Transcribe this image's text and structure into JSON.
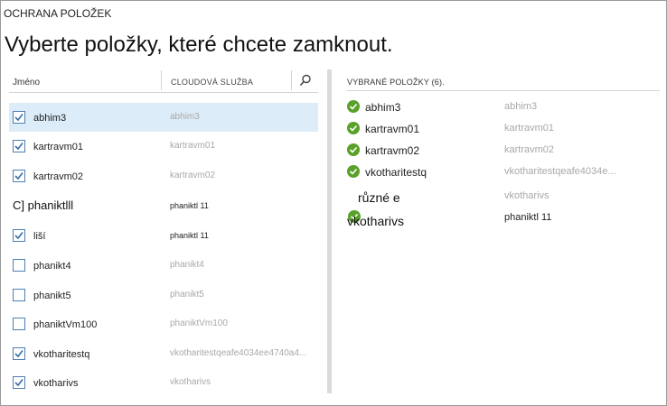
{
  "section_title": "OCHRANA POLOŽEK",
  "page_title": "Vyberte položky, které chcete zamknout.",
  "left": {
    "col_name": "Jméno",
    "col_service": "CLOUDOVÁ SLUŽBA",
    "rows": [
      {
        "name": "abhim3",
        "service": "abhim3",
        "checked": true,
        "selected": true
      },
      {
        "name": "kartravm01",
        "service": "kartravm01",
        "checked": true
      },
      {
        "name": "kartravm02",
        "service": "kartravm02",
        "checked": true
      },
      {
        "name": "C] phaniktlll",
        "service": "phaniktl 11",
        "checked": false
      },
      {
        "name": "liší",
        "service": "phaniktl 11",
        "checked": true
      },
      {
        "name": "phanikt4",
        "service": "phanikt4",
        "checked": false
      },
      {
        "name": "phanikt5",
        "service": "phanikt5",
        "checked": false
      },
      {
        "name": "phaniktVm100",
        "service": "phaniktVm100",
        "checked": false
      },
      {
        "name": "vkotharitestq",
        "service": "vkotharitestqeafe4034ee4740a4...",
        "checked": true
      },
      {
        "name": "vkotharivs",
        "service": "vkotharivs",
        "checked": true
      }
    ]
  },
  "right": {
    "title": "VYBRANÉ POLOŽKY (6).",
    "rows": [
      {
        "name": "abhim3",
        "service": "abhim3"
      },
      {
        "name": "kartravm01",
        "service": "kartravm01"
      },
      {
        "name": "kartravm02",
        "service": "kartravm02"
      },
      {
        "name": "vkotharitestq",
        "service": "vkotharitestqeafe4034e..."
      },
      {
        "name": "různé e",
        "service": "vkotharivs"
      },
      {
        "name": "vkotharivs",
        "service": "phaniktl 11"
      }
    ]
  },
  "icons": {
    "search": "search-icon",
    "check": "checkmark-icon",
    "ok": "ok-circle-icon"
  },
  "colors": {
    "accent": "#4f7fb3",
    "selected_row": "#dcecf8",
    "ok_green": "#5aa12a"
  }
}
